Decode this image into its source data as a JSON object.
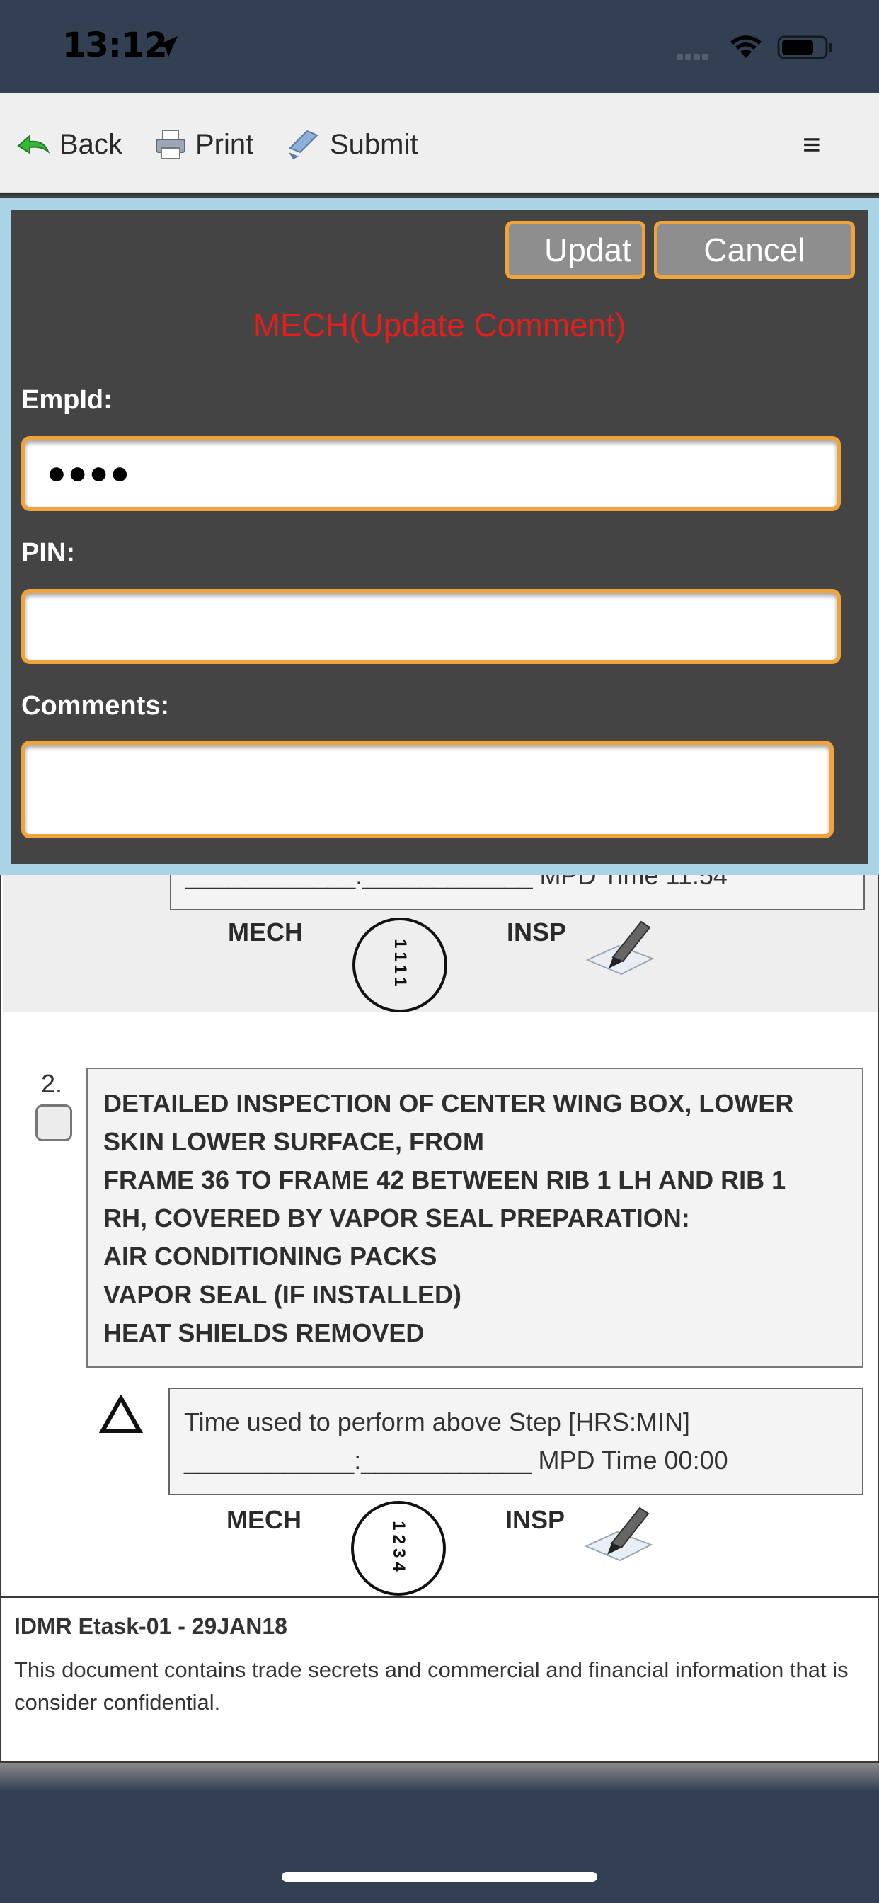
{
  "status_bar": {
    "time": "13:12",
    "icons": [
      "location-arrow-icon",
      "signal-icon",
      "wifi-icon",
      "battery-icon"
    ]
  },
  "toolbar": {
    "back_label": "Back",
    "print_label": "Print",
    "submit_label": "Submit",
    "menu_glyph": "≡"
  },
  "modal": {
    "update_label": "Updat",
    "cancel_label": "Cancel",
    "title": "MECH(Update Comment)",
    "empid_label": "EmpId:",
    "empid_value": "●●●●",
    "pin_label": "PIN:",
    "comments_label": "Comments:",
    "accent_color": "#efa33a",
    "title_color": "#e41d1d"
  },
  "document": {
    "step1": {
      "time_line_partial": "____________:____________ MPD Time 11:54",
      "mech_label": "MECH",
      "mech_stamp": "1111",
      "insp_label": "INSP"
    },
    "step2": {
      "number": "2.",
      "lines": [
        "DETAILED INSPECTION OF CENTER WING BOX, LOWER",
        "SKIN LOWER SURFACE, FROM",
        "FRAME 36 TO FRAME 42 BETWEEN RIB 1 LH AND RIB 1",
        "RH, COVERED BY VAPOR SEAL PREPARATION:",
        "AIR CONDITIONING PACKS",
        "VAPOR SEAL (IF INSTALLED)",
        "HEAT SHIELDS REMOVED"
      ],
      "time_title": "Time used to perform above Step [HRS:MIN]",
      "time_line": "____________:____________ MPD Time 00:00",
      "mech_label": "MECH",
      "mech_stamp": "1234",
      "insp_label": "INSP"
    },
    "footer": {
      "title": "IDMR Etask-01 - 29JAN18",
      "text": "This document contains trade secrets and commercial and financial information that is consider confidential."
    }
  }
}
